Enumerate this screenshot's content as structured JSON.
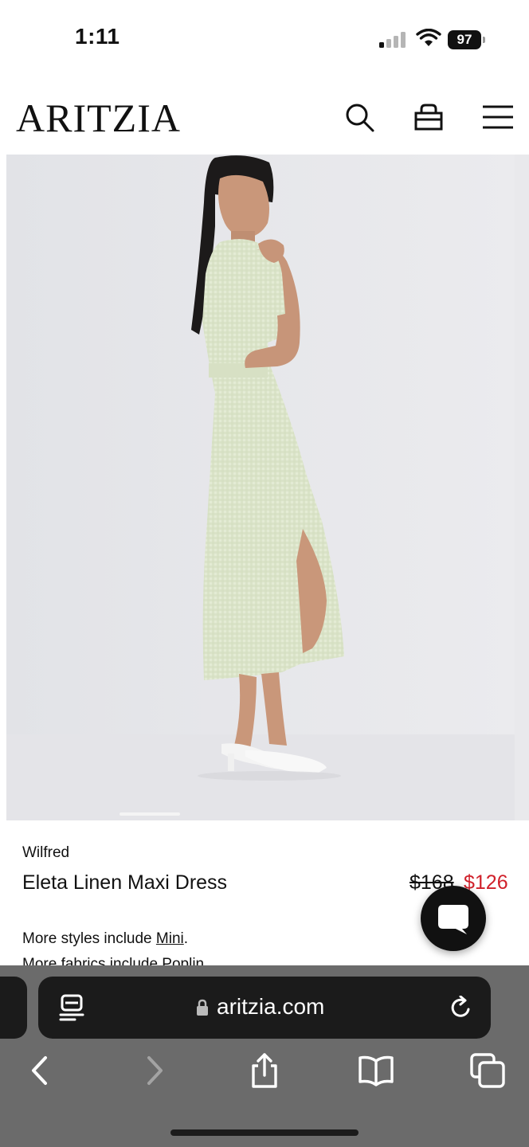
{
  "status_bar": {
    "time": "1:11",
    "battery": "97",
    "icons": [
      "signal-icon",
      "wifi-icon",
      "battery-icon"
    ]
  },
  "header": {
    "logo": "ARITZIA",
    "icons": [
      "search-icon",
      "shopping-bag-icon",
      "hamburger-menu-icon"
    ]
  },
  "product": {
    "image_description": "model wearing light green gingham linen maxi shirt dress",
    "brand": "Wilfred",
    "name": "Eleta Linen Maxi Dress",
    "price_original": "$168",
    "price_sale": "$126",
    "more_styles_prefix": "More styles include ",
    "more_styles_link": "Mini",
    "more_styles_suffix": ".",
    "more_fabrics": "More fabrics include Poplin."
  },
  "chat": {
    "icon": "chat-bubble-icon"
  },
  "browser": {
    "url": "aritzia.com",
    "toolbar_icons": [
      "back-icon",
      "forward-icon",
      "share-icon",
      "bookmarks-icon",
      "tabs-icon"
    ]
  },
  "colors": {
    "sale_price": "#d0202a",
    "toolbar_bg": "#6b6b6b",
    "dress_green": "#dfe8cf"
  }
}
